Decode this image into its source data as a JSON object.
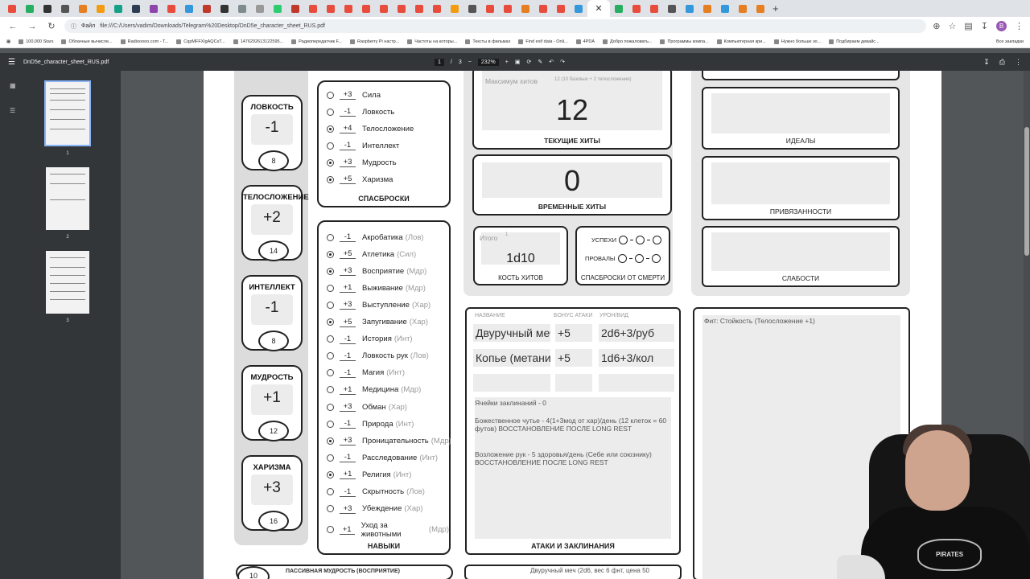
{
  "browser": {
    "address": "file:///C:/Users/vadim/Downloads/Telegram%20Desktop/DnD5e_character_sheet_RUS.pdf",
    "site_chip": "Файл",
    "profile_letter": "B"
  },
  "bookmarks": [
    "100,000 Stars",
    "Облачные вычисле...",
    "Radiooooo.com - T...",
    "CqpMFFXlgAQCsT...",
    "1476292613122595...",
    "Радиопередатчик F...",
    "Raspberry Pi настр...",
    "Частоты на которы...",
    "Тексты в фильмах",
    "Find exif data - Onli...",
    "4PDA",
    "Добро пожаловать...",
    "Программы компа...",
    "Компьютерная кри...",
    "Нужно больше зо...",
    "Подбираем девайс..."
  ],
  "bookmarks_all": "Все закладки",
  "pdf": {
    "filename": "DnD5e_character_sheet_RUS.pdf",
    "page_current": "1",
    "page_sep": "/",
    "page_total": "3",
    "zoom": "232%"
  },
  "thumbnails": [
    "1",
    "2",
    "3"
  ],
  "abilities": [
    {
      "name": "ЛОВКОСТЬ",
      "mod": "-1",
      "score": "8"
    },
    {
      "name": "ТЕЛОСЛОЖЕНИЕ",
      "mod": "+2",
      "score": "14"
    },
    {
      "name": "ИНТЕЛЛЕКТ",
      "mod": "-1",
      "score": "8"
    },
    {
      "name": "МУДРОСТЬ",
      "mod": "+1",
      "score": "12"
    },
    {
      "name": "ХАРИЗМА",
      "mod": "+3",
      "score": "16"
    }
  ],
  "saves": {
    "title": "СПАСБРОСКИ",
    "items": [
      {
        "mod": "+3",
        "name": "Сила",
        "on": false
      },
      {
        "mod": "-1",
        "name": "Ловкость",
        "on": false
      },
      {
        "mod": "+4",
        "name": "Телосложение",
        "on": true
      },
      {
        "mod": "-1",
        "name": "Интеллект",
        "on": false
      },
      {
        "mod": "+3",
        "name": "Мудрость",
        "on": true
      },
      {
        "mod": "+5",
        "name": "Харизма",
        "on": true
      }
    ]
  },
  "skills": {
    "title": "НАВЫКИ",
    "items": [
      {
        "mod": "-1",
        "name": "Акробатика",
        "attr": "(Лов)",
        "on": false
      },
      {
        "mod": "+5",
        "name": "Атлетика",
        "attr": "(Сил)",
        "on": true
      },
      {
        "mod": "+3",
        "name": "Восприятие",
        "attr": "(Мдр)",
        "on": true
      },
      {
        "mod": "+1",
        "name": "Выживание",
        "attr": "(Мдр)",
        "on": false
      },
      {
        "mod": "+3",
        "name": "Выступление",
        "attr": "(Хар)",
        "on": false
      },
      {
        "mod": "+5",
        "name": "Запугивание",
        "attr": "(Хар)",
        "on": true
      },
      {
        "mod": "-1",
        "name": "История",
        "attr": "(Инт)",
        "on": false
      },
      {
        "mod": "-1",
        "name": "Ловкость рук",
        "attr": "(Лов)",
        "on": false
      },
      {
        "mod": "-1",
        "name": "Магия",
        "attr": "(Инт)",
        "on": false
      },
      {
        "mod": "+1",
        "name": "Медицина",
        "attr": "(Мдр)",
        "on": false
      },
      {
        "mod": "+3",
        "name": "Обман",
        "attr": "(Хар)",
        "on": false
      },
      {
        "mod": "-1",
        "name": "Природа",
        "attr": "(Инт)",
        "on": false
      },
      {
        "mod": "+3",
        "name": "Проницательность",
        "attr": "(Мдр)",
        "on": true
      },
      {
        "mod": "-1",
        "name": "Расследование",
        "attr": "(Инт)",
        "on": false
      },
      {
        "mod": "+1",
        "name": "Религия",
        "attr": "(Инт)",
        "on": true
      },
      {
        "mod": "-1",
        "name": "Скрытность",
        "attr": "(Лов)",
        "on": false
      },
      {
        "mod": "+3",
        "name": "Убеждение",
        "attr": "(Хар)",
        "on": false
      },
      {
        "mod": "+1",
        "name": "Уход за животными",
        "attr": "(Мдр)",
        "on": false
      }
    ]
  },
  "hp": {
    "max_label": "Максимум хитов",
    "max_note": "12 (10 базовых + 2 телосложение)",
    "current": "12",
    "current_title": "ТЕКУЩИЕ ХИТЫ",
    "temp": "0",
    "temp_title": "ВРЕМЕННЫЕ ХИТЫ"
  },
  "hitdice": {
    "total_label": "Итого",
    "total": "1",
    "value": "1d10",
    "title": "КОСТЬ ХИТОВ"
  },
  "deathsaves": {
    "success": "УСПЕХИ",
    "fail": "ПРОВАЛЫ",
    "title": "СПАСБРОСКИ ОТ СМЕРТИ"
  },
  "traits": [
    "ИДЕАЛЫ",
    "ПРИВЯЗАННОСТИ",
    "СЛАБОСТИ"
  ],
  "attacks": {
    "headers": {
      "name": "НАЗВАНИЕ",
      "bonus": "БОНУС АТАКИ",
      "damage": "УРОН/ВИД"
    },
    "rows": [
      {
        "name": "Двуручный меч",
        "bonus": "+5",
        "damage": "2d6+3/руб"
      },
      {
        "name": "Копье (метание)",
        "bonus": "+5",
        "damage": "1d6+3/кол"
      }
    ],
    "slots": "Ячейки заклинаний - 0",
    "note1": "Божественное чутье   -  4(1+3мод от хар)/день (12 клеток = 60 футов) ВОССТАНОВЛЕНИЕ ПОСЛЕ LONG REST",
    "note2": "Возложение рук    -   5 здоровья/день (Себе или союзнику) ВОССТАНОВЛЕНИЕ ПОСЛЕ LONG REST",
    "title": "АТАКИ И ЗАКЛИНАНИЯ"
  },
  "features": {
    "text": "Фит: Стойкость (Телосложение +1)"
  },
  "bottom": {
    "left_num": "10",
    "left_label": "ПАССИВНАЯ МУДРОСТЬ (ВОСПРИЯТИЕ)",
    "right_text": "Двуручный меч (2d6, вес 6 фнт, цена 50"
  },
  "webcam": {
    "logo": "PIRATES"
  }
}
